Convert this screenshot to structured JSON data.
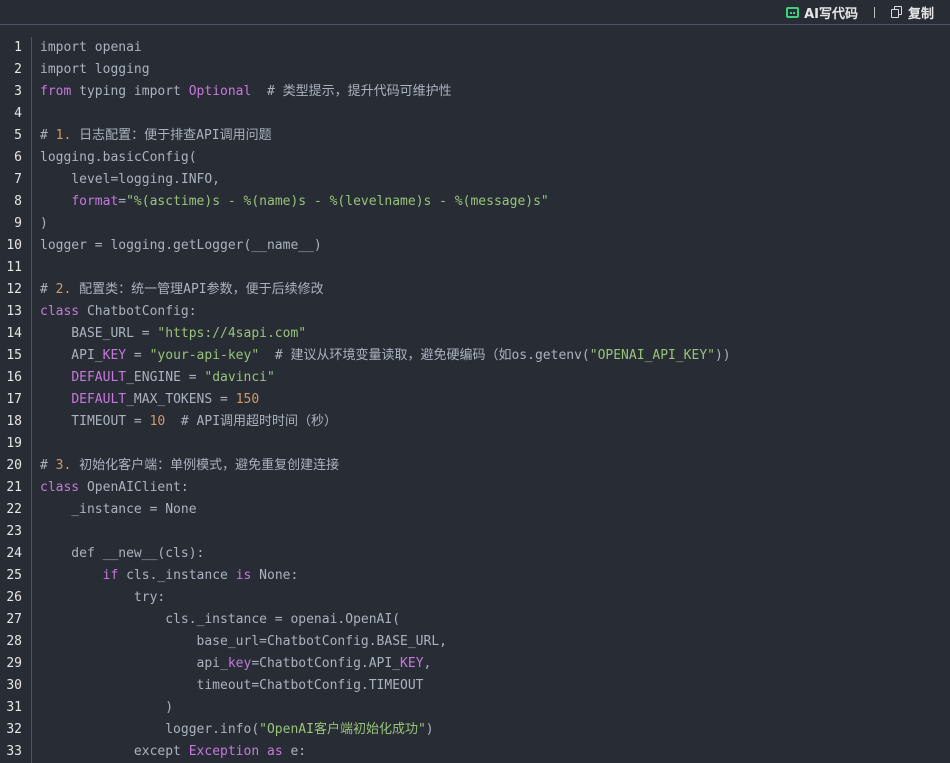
{
  "toolbar": {
    "ai_label": "AI写代码",
    "copy_label": "复制",
    "ai_icon": "robot-icon",
    "copy_icon": "copy-icon"
  },
  "code_lines": [
    {
      "n": "1",
      "t": [
        [
          "import openai",
          ""
        ]
      ]
    },
    {
      "n": "2",
      "t": [
        [
          "import logging",
          ""
        ]
      ]
    },
    {
      "n": "3",
      "t": [
        [
          "from",
          "kw"
        ],
        [
          " typing import ",
          ""
        ],
        [
          "Optional",
          "kw"
        ],
        [
          "  # 类型提示，提升代码可维护性",
          "cm"
        ]
      ]
    },
    {
      "n": "4",
      "t": []
    },
    {
      "n": "5",
      "t": [
        [
          "# ",
          "cm"
        ],
        [
          "1.",
          "cmn"
        ],
        [
          " 日志配置：便于排查API调用问题",
          "cm"
        ]
      ]
    },
    {
      "n": "6",
      "t": [
        [
          "logging.basicConfig(",
          ""
        ]
      ]
    },
    {
      "n": "7",
      "t": [
        [
          "    level=logging.INFO,",
          ""
        ]
      ]
    },
    {
      "n": "8",
      "t": [
        [
          "    ",
          ""
        ],
        [
          "format",
          "kw"
        ],
        [
          "=",
          ""
        ],
        [
          "\"%(asctime)s - %(name)s - %(levelname)s - %(message)s\"",
          "str"
        ]
      ]
    },
    {
      "n": "9",
      "t": [
        [
          ")",
          ""
        ]
      ]
    },
    {
      "n": "10",
      "t": [
        [
          "logger = logging.getLogger(__name__)",
          ""
        ]
      ]
    },
    {
      "n": "11",
      "t": []
    },
    {
      "n": "12",
      "t": [
        [
          "# ",
          "cm"
        ],
        [
          "2.",
          "cmn"
        ],
        [
          " 配置类：统一管理API参数，便于后续修改",
          "cm"
        ]
      ]
    },
    {
      "n": "13",
      "t": [
        [
          "class",
          "kw"
        ],
        [
          " ChatbotConfig:",
          ""
        ]
      ]
    },
    {
      "n": "14",
      "t": [
        [
          "    BASE_URL = ",
          ""
        ],
        [
          "\"https://4sapi.com\"",
          "str"
        ]
      ]
    },
    {
      "n": "15",
      "t": [
        [
          "    API_",
          ""
        ],
        [
          "KEY",
          "kw"
        ],
        [
          " = ",
          ""
        ],
        [
          "\"your-api-key\"",
          "str"
        ],
        [
          "  # 建议从环境变量读取，避免硬编码（如os.getenv(",
          "cm"
        ],
        [
          "\"OPENAI_API_KEY\"",
          "str"
        ],
        [
          "))",
          "cm"
        ]
      ]
    },
    {
      "n": "16",
      "t": [
        [
          "    ",
          ""
        ],
        [
          "DEFAULT",
          "kw"
        ],
        [
          "_ENGINE = ",
          ""
        ],
        [
          "\"davinci\"",
          "str"
        ]
      ]
    },
    {
      "n": "17",
      "t": [
        [
          "    ",
          ""
        ],
        [
          "DEFAULT",
          "kw"
        ],
        [
          "_MAX_TOKENS = ",
          ""
        ],
        [
          "150",
          "num"
        ]
      ]
    },
    {
      "n": "18",
      "t": [
        [
          "    TIMEOUT = ",
          ""
        ],
        [
          "10",
          "num"
        ],
        [
          "  # API调用超时时间（秒）",
          "cm"
        ]
      ]
    },
    {
      "n": "19",
      "t": []
    },
    {
      "n": "20",
      "t": [
        [
          "# ",
          "cm"
        ],
        [
          "3.",
          "cmn"
        ],
        [
          " 初始化客户端：单例模式，避免重复创建连接",
          "cm"
        ]
      ]
    },
    {
      "n": "21",
      "t": [
        [
          "class",
          "kw"
        ],
        [
          " OpenAIClient:",
          ""
        ]
      ]
    },
    {
      "n": "22",
      "t": [
        [
          "    _instance = None",
          ""
        ]
      ]
    },
    {
      "n": "23",
      "t": []
    },
    {
      "n": "24",
      "t": [
        [
          "    def __new__(cls):",
          ""
        ]
      ]
    },
    {
      "n": "25",
      "t": [
        [
          "        ",
          ""
        ],
        [
          "if",
          "kw"
        ],
        [
          " cls._instance ",
          ""
        ],
        [
          "is",
          "kw"
        ],
        [
          " None:",
          ""
        ]
      ]
    },
    {
      "n": "26",
      "t": [
        [
          "            try:",
          ""
        ]
      ]
    },
    {
      "n": "27",
      "t": [
        [
          "                cls._instance = openai.OpenAI(",
          ""
        ]
      ]
    },
    {
      "n": "28",
      "t": [
        [
          "                    base_url=ChatbotConfig.BASE_URL,",
          ""
        ]
      ]
    },
    {
      "n": "29",
      "t": [
        [
          "                    api_",
          ""
        ],
        [
          "key",
          "kw"
        ],
        [
          "=ChatbotConfig.API_",
          ""
        ],
        [
          "KEY",
          "kw"
        ],
        [
          ",",
          ""
        ]
      ]
    },
    {
      "n": "30",
      "t": [
        [
          "                    timeout=ChatbotConfig.TIMEOUT",
          ""
        ]
      ]
    },
    {
      "n": "31",
      "t": [
        [
          "                )",
          ""
        ]
      ]
    },
    {
      "n": "32",
      "t": [
        [
          "                logger.info(",
          ""
        ],
        [
          "\"OpenAI客户端初始化成功\"",
          "str"
        ],
        [
          ")",
          ""
        ]
      ]
    },
    {
      "n": "33",
      "t": [
        [
          "            except ",
          ""
        ],
        [
          "Exception",
          "kw"
        ],
        [
          " ",
          ""
        ],
        [
          "as",
          "kw"
        ],
        [
          " e:",
          ""
        ]
      ]
    }
  ]
}
